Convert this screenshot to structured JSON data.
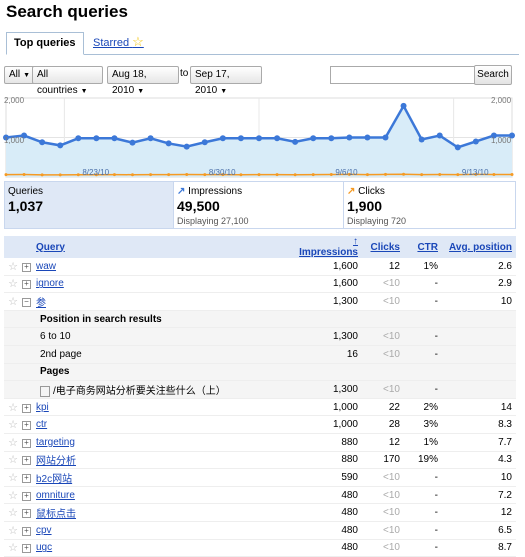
{
  "page_title": "Search queries",
  "tabs": {
    "top": "Top queries",
    "starred": "Starred"
  },
  "filters": {
    "type": "All",
    "country": "All countries",
    "date_from": "Aug 18, 2010",
    "to": "to",
    "date_to": "Sep 17, 2010",
    "search_button": "Search",
    "search_value": ""
  },
  "chart": {
    "y_labels": {
      "top_left": "2,000",
      "mid_left": "1,000",
      "top_right": "2,000",
      "mid_right": "1,000"
    },
    "x_labels": [
      "8/23/10",
      "8/30/10",
      "9/6/10",
      "9/13/10"
    ],
    "impressions": [
      1000,
      1050,
      880,
      800,
      980,
      980,
      980,
      870,
      980,
      850,
      770,
      880,
      980,
      980,
      980,
      980,
      890,
      980,
      980,
      1000,
      1000,
      1000,
      1800,
      950,
      1050,
      750,
      900,
      1050,
      1050
    ],
    "clicks": [
      60,
      62,
      55,
      55,
      58,
      58,
      60,
      58,
      60,
      60,
      62,
      60,
      60,
      58,
      60,
      60,
      58,
      60,
      62,
      65,
      60,
      65,
      70,
      60,
      62,
      60,
      65,
      62,
      62
    ],
    "colors": {
      "impressions": "#3c78d8",
      "clicks": "#f59a23",
      "fill": "#d8ecf8"
    }
  },
  "stats": {
    "queries": {
      "label": "Queries",
      "value": "1,037"
    },
    "impressions": {
      "label": "Impressions",
      "value": "49,500",
      "display": "Displaying 27,100"
    },
    "clicks": {
      "label": "Clicks",
      "value": "1,900",
      "display": "Displaying 720"
    }
  },
  "table": {
    "headers": {
      "query": "Query",
      "impressions": "Impressions",
      "clicks": "Clicks",
      "ctr": "CTR",
      "avg_position": "Avg. position"
    },
    "rows": [
      {
        "query": "waw",
        "impressions": "1,600",
        "clicks": "12",
        "ctr": "1%",
        "pos": "2.6"
      },
      {
        "query": "ignore",
        "impressions": "1,600",
        "clicks": "<10",
        "ctr": "-",
        "pos": "2.9"
      },
      {
        "query": "参",
        "impressions": "1,300",
        "clicks": "<10",
        "ctr": "-",
        "pos": "10"
      },
      {
        "query": "kpi",
        "impressions": "1,000",
        "clicks": "22",
        "ctr": "2%",
        "pos": "14"
      },
      {
        "query": "ctr",
        "impressions": "1,000",
        "clicks": "28",
        "ctr": "3%",
        "pos": "8.3"
      },
      {
        "query": "targeting",
        "impressions": "880",
        "clicks": "12",
        "ctr": "1%",
        "pos": "7.7"
      },
      {
        "query": "网站分析",
        "impressions": "880",
        "clicks": "170",
        "ctr": "19%",
        "pos": "4.3"
      },
      {
        "query": "b2c网站",
        "impressions": "590",
        "clicks": "<10",
        "ctr": "-",
        "pos": "10"
      },
      {
        "query": "omniture",
        "impressions": "480",
        "clicks": "<10",
        "ctr": "-",
        "pos": "7.2"
      },
      {
        "query": "鼠标点击",
        "impressions": "480",
        "clicks": "<10",
        "ctr": "-",
        "pos": "12"
      },
      {
        "query": "cpv",
        "impressions": "480",
        "clicks": "<10",
        "ctr": "-",
        "pos": "6.5"
      },
      {
        "query": "ugc",
        "impressions": "480",
        "clicks": "<10",
        "ctr": "-",
        "pos": "8.7"
      }
    ],
    "expanded": {
      "position_heading": "Position in search results",
      "positions": [
        {
          "label": "6 to 10",
          "impressions": "1,300",
          "clicks": "<10",
          "ctr": "-"
        },
        {
          "label": "2nd page",
          "impressions": "16",
          "clicks": "<10",
          "ctr": "-"
        }
      ],
      "pages_heading": "Pages",
      "pages": [
        {
          "label": "/电子商务网站分析要关注些什么（上）",
          "impressions": "1,300",
          "clicks": "<10",
          "ctr": "-"
        }
      ]
    }
  }
}
